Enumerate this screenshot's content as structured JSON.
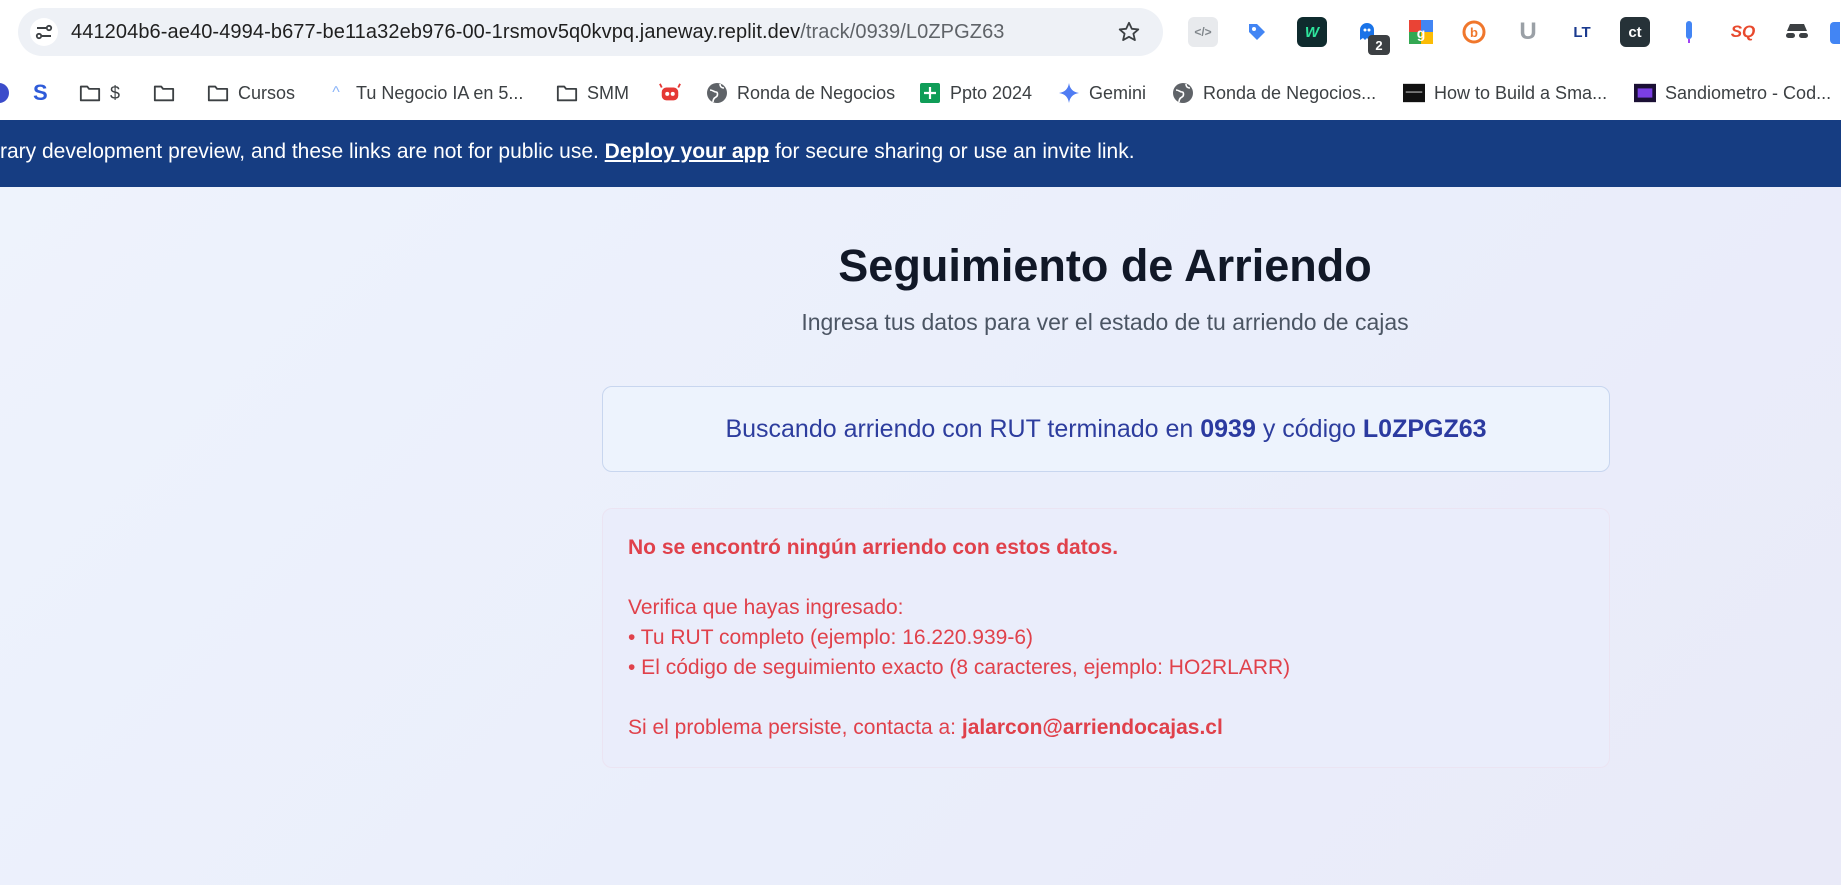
{
  "browser": {
    "url_host": "441204b6-ae40-4994-b677-be11a32eb976-00-1rsmov5q0kvpq.janeway.replit.dev",
    "url_path": "/track/0939/L0ZPGZ63",
    "extensions": {
      "badge_count": "2"
    },
    "bookmarks": [
      {
        "label": "S"
      },
      {
        "label": "$"
      },
      {
        "label": ""
      },
      {
        "label": "Cursos"
      },
      {
        "label": "Tu Negocio IA en 5..."
      },
      {
        "label": "SMM"
      },
      {
        "label": ""
      },
      {
        "label": "Ronda de Negocios"
      },
      {
        "label": "Ppto 2024"
      },
      {
        "label": "Gemini"
      },
      {
        "label": "Ronda de Negocios..."
      },
      {
        "label": "How to Build a Sma..."
      },
      {
        "label": "Sandiometro - Cod..."
      }
    ]
  },
  "banner": {
    "text_before": "rary development preview, and these links are not for public use.",
    "link": "Deploy your app",
    "text_after": "for secure sharing or use an invite link."
  },
  "page": {
    "title": "Seguimiento de Arriendo",
    "subtitle": "Ingresa tus datos para ver el estado de tu arriendo de cajas",
    "search": {
      "prefix": "Buscando arriendo con RUT terminado en",
      "rut_suffix": "0939",
      "middle": "y código",
      "code": "L0ZPGZ63"
    },
    "error": {
      "heading": "No se encontró ningún arriendo con estos datos.",
      "verify": "Verifica que hayas ingresado:",
      "bullet_1": "• Tu RUT completo (ejemplo: 16.220.939-6)",
      "bullet_2": "• El código de seguimiento exacto (8 caracteres, ejemplo: HO2RLARR)",
      "contact_prefix": "Si el problema persiste, contacta a:",
      "contact_email": "jalarcon@arriendocajas.cl"
    }
  },
  "colors": {
    "banner_bg": "#163d82",
    "error_text": "#e0414b",
    "search_text": "#2d3d9e",
    "title_text": "#111827"
  }
}
